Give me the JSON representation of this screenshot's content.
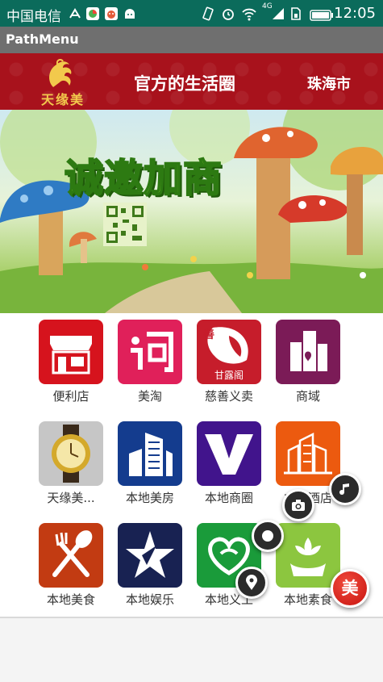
{
  "status_bar": {
    "carrier": "中国电信",
    "network": "4G",
    "time": "12:05"
  },
  "action_bar": {
    "title": "PathMenu"
  },
  "header": {
    "logo_text": "天缘美",
    "slogan": "官方的生活圈",
    "city": "珠海市"
  },
  "banner": {
    "headline": "诚邀加商"
  },
  "categories": [
    {
      "label": "便利店",
      "icon": "storefront-icon"
    },
    {
      "label": "美淘",
      "icon": "tao-character-icon"
    },
    {
      "label": "慈善义卖",
      "icon": "charity-gan-lu-ge-icon",
      "tile_text": "甘露阁",
      "tile_mark": "善"
    },
    {
      "label": "商域",
      "icon": "commerce-buildings-icon"
    },
    {
      "label": "天缘美...",
      "icon": "gold-watch-icon"
    },
    {
      "label": "本地美房",
      "icon": "real-estate-building-icon"
    },
    {
      "label": "本地商圈",
      "icon": "v-letter-icon"
    },
    {
      "label": "本地酒店",
      "icon": "hotel-building-icon"
    },
    {
      "label": "本地美食",
      "icon": "fork-spoon-icon"
    },
    {
      "label": "本地娱乐",
      "icon": "star-icon"
    },
    {
      "label": "本地义工",
      "icon": "volunteer-hearts-icon"
    },
    {
      "label": "本地素食",
      "icon": "lotus-hand-icon"
    }
  ],
  "path_menu": {
    "main_label": "美",
    "items": [
      "music-note-icon",
      "camera-icon",
      "bubble-icon",
      "location-pin-icon"
    ]
  }
}
